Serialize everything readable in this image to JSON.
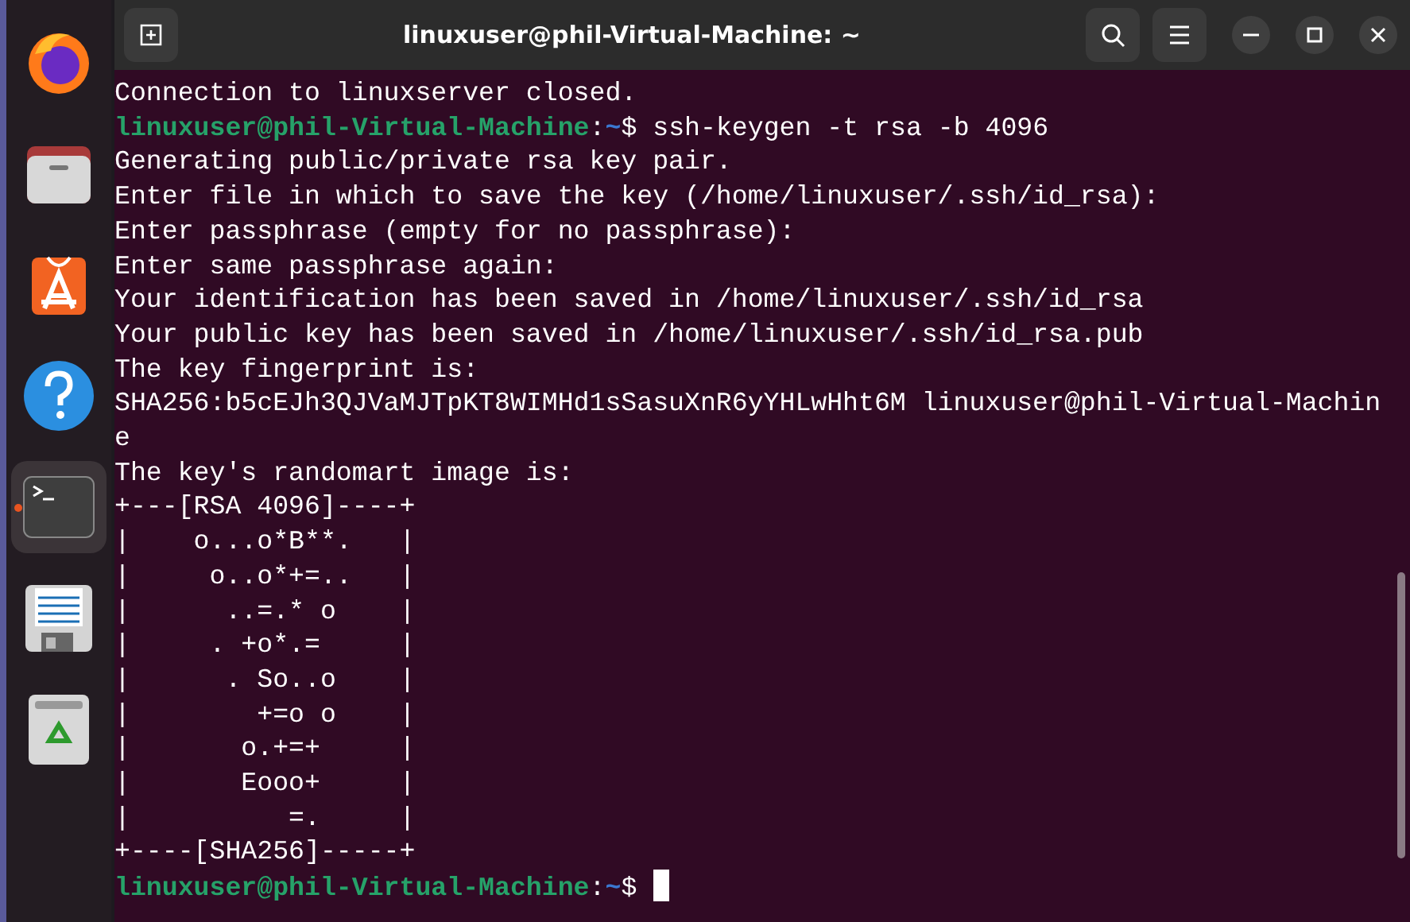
{
  "dock": {
    "items": [
      {
        "kind": "firefox",
        "selected": false
      },
      {
        "kind": "files",
        "selected": false
      },
      {
        "kind": "appcenter",
        "selected": false
      },
      {
        "kind": "help",
        "selected": false
      },
      {
        "kind": "terminal",
        "selected": true
      },
      {
        "kind": "editor",
        "selected": false
      },
      {
        "kind": "trash",
        "selected": false
      }
    ]
  },
  "window": {
    "title": "linuxuser@phil-Virtual-Machine: ~"
  },
  "terminal": {
    "lines": [
      {
        "kind": "output",
        "text": "Connection to linuxserver closed."
      },
      {
        "kind": "prompt",
        "user": "linuxuser@phil-Virtual-Machine",
        "separator": ":",
        "path": "~",
        "symbol": "$",
        "command": "ssh-keygen -t rsa -b 4096"
      },
      {
        "kind": "output",
        "text": "Generating public/private rsa key pair."
      },
      {
        "kind": "output",
        "text": "Enter file in which to save the key (/home/linuxuser/.ssh/id_rsa):"
      },
      {
        "kind": "output",
        "text": "Enter passphrase (empty for no passphrase):"
      },
      {
        "kind": "output",
        "text": "Enter same passphrase again:"
      },
      {
        "kind": "output",
        "text": "Your identification has been saved in /home/linuxuser/.ssh/id_rsa"
      },
      {
        "kind": "output",
        "text": "Your public key has been saved in /home/linuxuser/.ssh/id_rsa.pub"
      },
      {
        "kind": "output",
        "text": "The key fingerprint is:"
      },
      {
        "kind": "output",
        "text": "SHA256:b5cEJh3QJVaMJTpKT8WIMHd1sSasuXnR6yYHLwHht6M linuxuser@phil-Virtual-Machin"
      },
      {
        "kind": "output",
        "text": "e"
      },
      {
        "kind": "output",
        "text": "The key's randomart image is:"
      },
      {
        "kind": "output",
        "text": "+---[RSA 4096]----+"
      },
      {
        "kind": "output",
        "text": "|    o...o*B**.   |"
      },
      {
        "kind": "output",
        "text": "|     o..o*+=..   |"
      },
      {
        "kind": "output",
        "text": "|      ..=.* o    |"
      },
      {
        "kind": "output",
        "text": "|     . +o*.=     |"
      },
      {
        "kind": "output",
        "text": "|      . So..o    |"
      },
      {
        "kind": "output",
        "text": "|        +=o o    |"
      },
      {
        "kind": "output",
        "text": "|       o.+=+     |"
      },
      {
        "kind": "output",
        "text": "|       Eooo+     |"
      },
      {
        "kind": "output",
        "text": "|          =.     |"
      },
      {
        "kind": "output",
        "text": "+----[SHA256]-----+"
      },
      {
        "kind": "prompt",
        "user": "linuxuser@phil-Virtual-Machine",
        "separator": ":",
        "path": "~",
        "symbol": "$",
        "cursor": true
      }
    ]
  }
}
